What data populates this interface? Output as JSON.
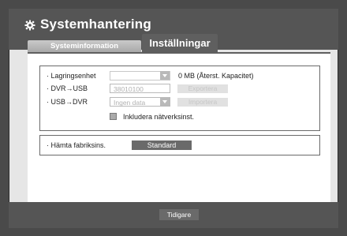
{
  "window": {
    "title": "Systemhantering"
  },
  "tabs": [
    {
      "label": "Systeminformation",
      "active": false
    },
    {
      "label": "Inställningar",
      "active": true
    }
  ],
  "storage": {
    "label": "· Lagringsenhet",
    "value": "",
    "capacity": "0 MB (Återst. Kapacitet)"
  },
  "dvr_usb": {
    "label": "· DVR→USB",
    "value": "38010100",
    "button": "Exportera"
  },
  "usb_dvr": {
    "label": "· USB→DVR",
    "value": "Ingen data",
    "button": "Importera"
  },
  "include_network": {
    "label": "Inkludera nätverksinst.",
    "checked": false
  },
  "factory": {
    "label": "· Hämta fabriksins.",
    "button": "Standard"
  },
  "footer": {
    "back_button": "Tidigare"
  },
  "colors": {
    "outer": "#4a4a4a",
    "header": "#555555",
    "panel": "#ffffff",
    "button_dark": "#6a6a6a"
  },
  "icons": {
    "title_icon": "gear-icon",
    "dropdown_icon": "chevron-down-icon"
  }
}
